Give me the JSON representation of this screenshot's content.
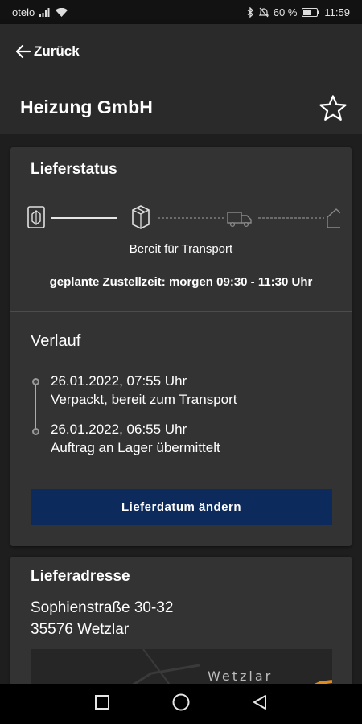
{
  "status_bar": {
    "carrier": "otelo",
    "battery": "60 %",
    "time": "11:59"
  },
  "header": {
    "back_label": "Zurück",
    "title": "Heizung GmbH"
  },
  "delivery_card": {
    "title": "Lieferstatus",
    "progress_steps": [
      "order-received",
      "package",
      "truck",
      "house"
    ],
    "current_step": 2,
    "status_text": "Bereit für Transport",
    "eta": "geplante Zustellzeit: morgen 09:30 - 11:30 Uhr",
    "history_title": "Verlauf",
    "history": [
      {
        "timestamp": "26.01.2022, 07:55 Uhr",
        "text": "Verpackt, bereit zum Transport"
      },
      {
        "timestamp": "26.01.2022, 06:55 Uhr",
        "text": "Auftrag an Lager übermittelt"
      }
    ],
    "button_label": "Lieferdatum ändern"
  },
  "address_card": {
    "title": "Lieferadresse",
    "street": "Sophienstraße 30-32",
    "city": "35576 Wetzlar",
    "map_label": "Wetzlar"
  },
  "colors": {
    "background": "#1e1e1e",
    "card": "#333333",
    "header": "#2a2a2a",
    "button": "#0d2a5c",
    "map_road": "#e08a1e"
  },
  "icons": [
    "signal-icon",
    "wifi-icon",
    "bluetooth-icon",
    "mute-icon",
    "battery-icon",
    "back-arrow-icon",
    "star-icon",
    "nav-square-icon",
    "nav-circle-icon",
    "nav-triangle-icon"
  ]
}
